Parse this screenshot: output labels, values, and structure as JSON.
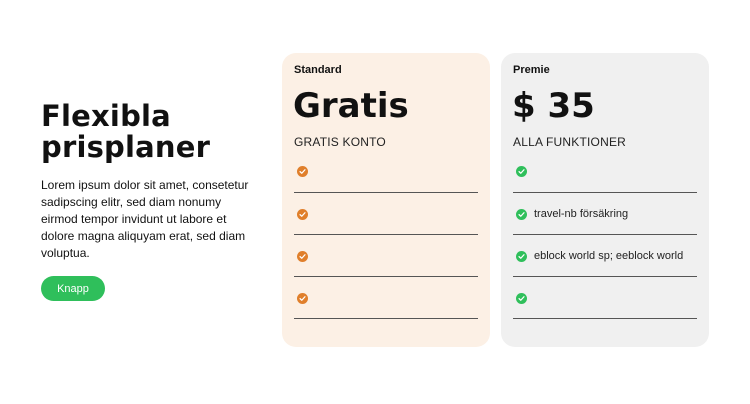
{
  "intro": {
    "title_line1": "Flexibla",
    "title_line2": "prisplaner",
    "body": "Lorem ipsum dolor sit amet, consetetur sadipscing elitr, sed diam nonumy eirmod tempor invidunt ut labore et dolore magna aliquyam erat, sed diam voluptua.",
    "button_label": "Knapp"
  },
  "colors": {
    "accent_green": "#2fbf5b",
    "accent_orange": "#e07f2b",
    "standard_card_bg": "#fcf0e5",
    "premium_card_bg": "#f0f0f0"
  },
  "plans": [
    {
      "name": "Standard",
      "price": "Gratis",
      "subtitle": "GRATIS KONTO",
      "check_icon": "check-circle-icon",
      "features": [
        "",
        "",
        "",
        ""
      ]
    },
    {
      "name": "Premie",
      "price": "$ 35",
      "subtitle": "ALLA FUNKTIONER",
      "check_icon": "check-circle-icon",
      "features": [
        "",
        "travel-nb försäkring",
        "eblock world sp; eeblock world",
        ""
      ]
    }
  ]
}
